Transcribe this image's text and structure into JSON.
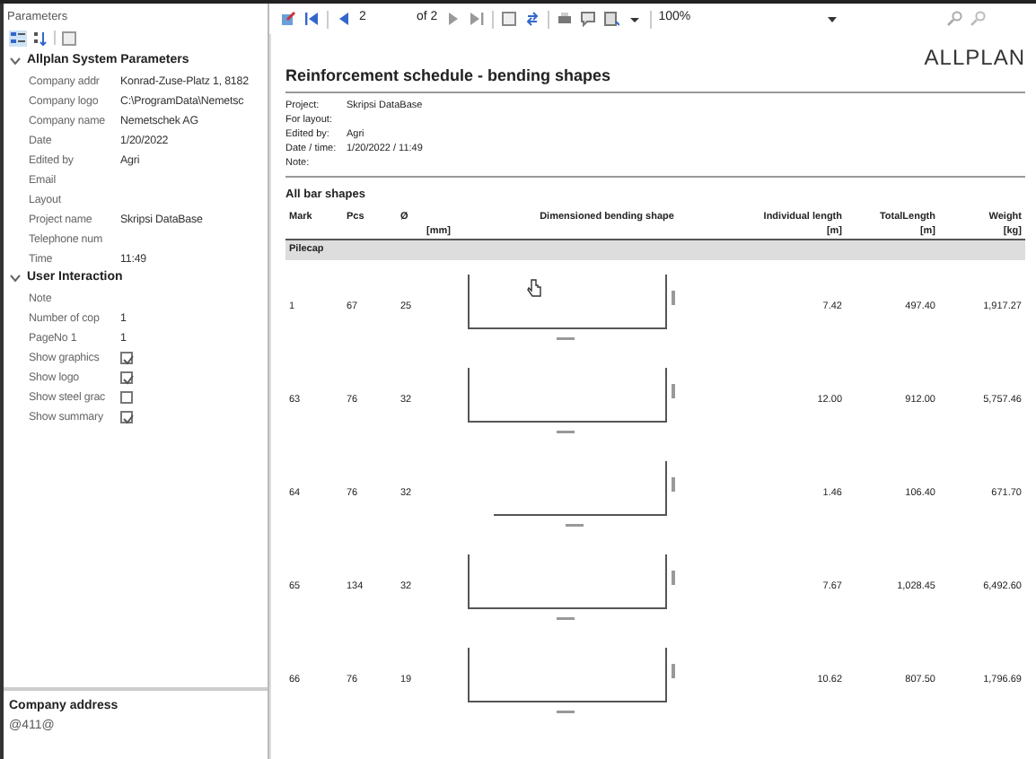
{
  "parameters": {
    "title": "Parameters",
    "sections": [
      {
        "name": "Allplan System Parameters",
        "expanded": true,
        "props": [
          {
            "name": "Company addr",
            "kind": "text",
            "value": "Konrad-Zuse-Platz 1, 8182"
          },
          {
            "name": "Company logo",
            "kind": "text",
            "value": "C:\\ProgramData\\Nemetsc"
          },
          {
            "name": "Company name",
            "kind": "text",
            "value": "Nemetschek AG"
          },
          {
            "name": "Date",
            "kind": "text",
            "value": "1/20/2022"
          },
          {
            "name": "Edited by",
            "kind": "text",
            "value": "Agri"
          },
          {
            "name": "Email",
            "kind": "text"
          },
          {
            "name": "Layout",
            "kind": "text"
          },
          {
            "name": "Project name",
            "kind": "text",
            "value": "Skripsi DataBase"
          },
          {
            "name": "Telephone num",
            "kind": "text"
          },
          {
            "name": "Time",
            "kind": "text",
            "value": "11:49"
          }
        ]
      },
      {
        "name": "User Interaction",
        "expanded": true,
        "props": [
          {
            "name": "Note",
            "kind": "text"
          },
          {
            "name": "Number of cop",
            "kind": "text",
            "value": "1"
          },
          {
            "name": "PageNo 1",
            "kind": "text",
            "value": "1"
          },
          {
            "name": "Show graphics",
            "kind": "check",
            "checked": true
          },
          {
            "name": "Show logo",
            "kind": "check",
            "checked": true
          },
          {
            "name": "Show steel grac",
            "kind": "check",
            "checked": false
          },
          {
            "name": "Show summary",
            "kind": "check",
            "checked": true
          }
        ]
      }
    ],
    "help": {
      "title": "Company address",
      "text": "@411@"
    }
  },
  "toolbar": {
    "page": "2",
    "page_count": "of 2",
    "zoom": "100%"
  },
  "report": {
    "title": "Reinforcement schedule - bending shapes",
    "logo": "ALLPLAN",
    "info": [
      {
        "label": "Project:",
        "value": "Skripsi DataBase"
      },
      {
        "label": "For layout:"
      },
      {
        "label": "Edited by:",
        "value": "Agri"
      },
      {
        "label": "Date / time:",
        "value": "1/20/2022  /  11:49"
      },
      {
        "label": "Note:"
      }
    ],
    "section_title": "All bar shapes",
    "columns": [
      {
        "name": "Mark"
      },
      {
        "name": "Pcs"
      },
      {
        "name": "Ø",
        "unit": "[mm]"
      },
      {
        "name": "Dimensioned bending shape"
      },
      {
        "name": "Individual length",
        "unit": "[m]"
      },
      {
        "name": "TotalLength",
        "unit": "[m]"
      },
      {
        "name": "Weight",
        "unit": "[kg]"
      }
    ],
    "group": "Pilecap",
    "rows": [
      {
        "mark": "1",
        "pcs": "67",
        "dia": "25",
        "kind": "u",
        "length": "7.42",
        "total": "497.40",
        "weight": "1,917.27"
      },
      {
        "mark": "63",
        "pcs": "76",
        "dia": "32",
        "kind": "u",
        "length": "12.00",
        "total": "912.00",
        "weight": "5,757.46"
      },
      {
        "mark": "64",
        "pcs": "76",
        "dia": "32",
        "kind": "l",
        "length": "1.46",
        "total": "106.40",
        "weight": "671.70"
      },
      {
        "mark": "65",
        "pcs": "134",
        "dia": "32",
        "kind": "u",
        "length": "7.67",
        "total": "1,028.45",
        "weight": "6,492.60"
      },
      {
        "mark": "66",
        "pcs": "76",
        "dia": "19",
        "kind": "u",
        "length": "10.62",
        "total": "807.50",
        "weight": "1,796.69"
      }
    ]
  }
}
